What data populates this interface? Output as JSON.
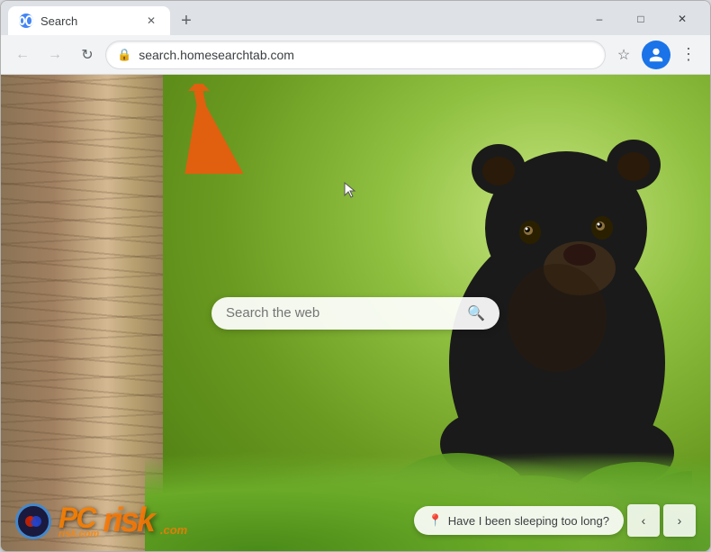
{
  "browser": {
    "tab": {
      "title": "Search",
      "favicon": "globe-icon"
    },
    "new_tab_label": "+",
    "window_controls": {
      "minimize": "–",
      "maximize": "□",
      "close": "✕"
    },
    "nav": {
      "back_label": "←",
      "forward_label": "→",
      "reload_label": "↻"
    },
    "address_bar": {
      "url": "search.homesearchtab.com",
      "placeholder": "search.homesearchtab.com"
    },
    "bookmark_label": "☆",
    "profile_label": "👤",
    "menu_label": "⋮"
  },
  "page": {
    "search_placeholder": "Search the web",
    "search_icon": "🔍",
    "suggestion": {
      "icon": "📍",
      "text": "Have I been sleeping too long?"
    },
    "nav_prev": "‹",
    "nav_next": "›",
    "pcrisk": {
      "text": "PC",
      "suffix": "risk.com"
    }
  },
  "colors": {
    "accent_blue": "#1a73e8",
    "tab_bg": "#ffffff",
    "toolbar_bg": "#f1f3f4",
    "chrome_bg": "#dee1e6"
  }
}
